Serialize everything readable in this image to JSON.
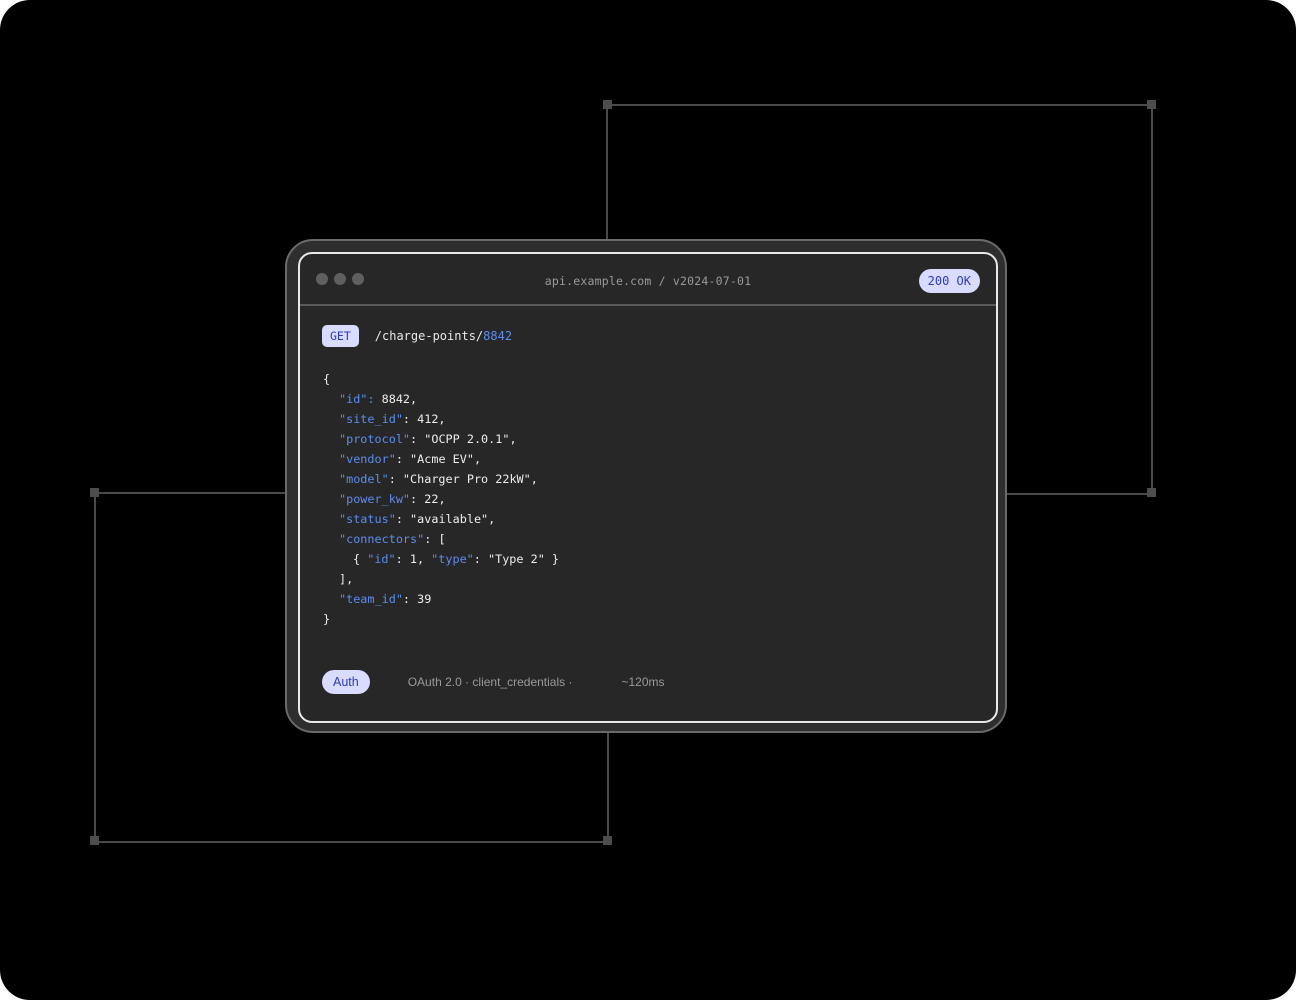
{
  "window": {
    "title": "api.example.com / v2024-07-01",
    "status": "200 OK"
  },
  "request": {
    "method": "GET",
    "path_prefix": "/charge-points/",
    "path_id": "8842"
  },
  "response_lines": [
    {
      "indent": 0,
      "segments": [
        {
          "t": "p",
          "s": "{"
        }
      ]
    },
    {
      "indent": 1,
      "segments": [
        {
          "t": "k",
          "s": "\"id\":"
        },
        {
          "t": "p",
          "s": " 8842,"
        }
      ]
    },
    {
      "indent": 1,
      "segments": [
        {
          "t": "k",
          "s": "\"site_id\""
        },
        {
          "t": "p",
          "s": ": 412,"
        }
      ]
    },
    {
      "indent": 1,
      "segments": [
        {
          "t": "k",
          "s": "\"protocol\""
        },
        {
          "t": "p",
          "s": ": \"OCPP 2.0.1\","
        }
      ]
    },
    {
      "indent": 1,
      "segments": [
        {
          "t": "k",
          "s": "\"vendor\""
        },
        {
          "t": "p",
          "s": ": \"Acme EV\","
        }
      ]
    },
    {
      "indent": 1,
      "segments": [
        {
          "t": "k",
          "s": "\"model\""
        },
        {
          "t": "p",
          "s": ": \"Charger Pro 22kW\","
        }
      ]
    },
    {
      "indent": 1,
      "segments": [
        {
          "t": "k",
          "s": "\"power_kw\""
        },
        {
          "t": "p",
          "s": ": 22,"
        }
      ]
    },
    {
      "indent": 1,
      "segments": [
        {
          "t": "k",
          "s": "\"status\""
        },
        {
          "t": "p",
          "s": ": \"available\","
        }
      ]
    },
    {
      "indent": 1,
      "segments": [
        {
          "t": "k",
          "s": "\"connectors\""
        },
        {
          "t": "p",
          "s": ": ["
        }
      ]
    },
    {
      "indent": 2,
      "segments": [
        {
          "t": "p",
          "s": "{ "
        },
        {
          "t": "k",
          "s": "\"id\""
        },
        {
          "t": "p",
          "s": ": 1, "
        },
        {
          "t": "k",
          "s": "\"type\""
        },
        {
          "t": "p",
          "s": ": \"Type 2\" }"
        }
      ]
    },
    {
      "indent": 1,
      "segments": [
        {
          "t": "p",
          "s": "],"
        }
      ]
    },
    {
      "indent": 1,
      "segments": [
        {
          "t": "k",
          "s": "\"team_id\""
        },
        {
          "t": "p",
          "s": ": 39"
        }
      ]
    },
    {
      "indent": 0,
      "segments": [
        {
          "t": "p",
          "s": "}"
        }
      ]
    }
  ],
  "footer": {
    "auth_label": "Auth",
    "auth_detail": "OAuth 2.0 · client_credentials ·",
    "latency": "~120ms"
  },
  "colors": {
    "background": "#000000",
    "accent_badge": "#d9dcff",
    "accent_text": "#2f3bb3",
    "json_key": "#5b8def"
  }
}
